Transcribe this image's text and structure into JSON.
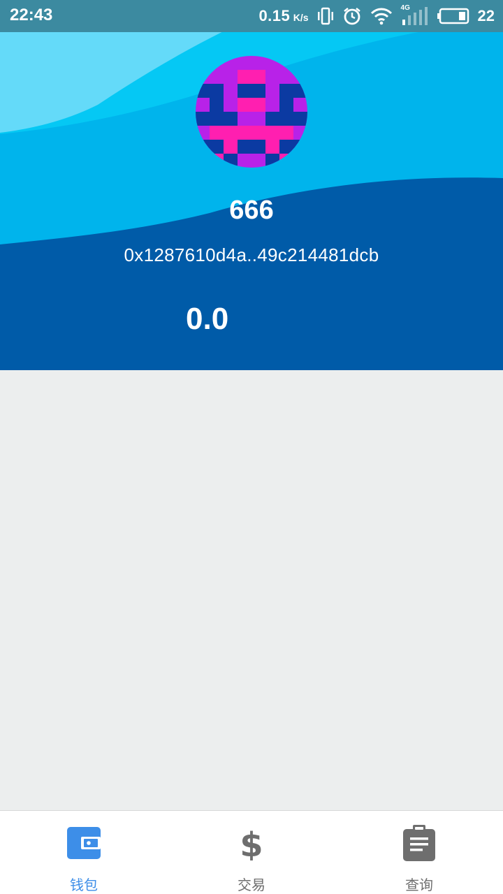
{
  "status_bar": {
    "time": "22:43",
    "net_speed": "0.15",
    "net_unit": "K/s",
    "network_type": "4G",
    "battery": "22"
  },
  "wallet": {
    "name": "666",
    "address": "0x1287610d4a..49c214481dcb",
    "balance": "0.0"
  },
  "nav": {
    "items": [
      {
        "label": "钱包",
        "icon": "wallet-icon",
        "active": true
      },
      {
        "label": "交易",
        "icon": "dollar-icon",
        "active": false
      },
      {
        "label": "查询",
        "icon": "clipboard-icon",
        "active": false
      }
    ],
    "active_color": "#3d8ee8",
    "inactive_color": "#6e6e6e"
  },
  "colors": {
    "header_dark": "#005ba8",
    "header_mid": "#00b4ec",
    "header_light": "#6fdcfa",
    "background": "#eceeee"
  }
}
